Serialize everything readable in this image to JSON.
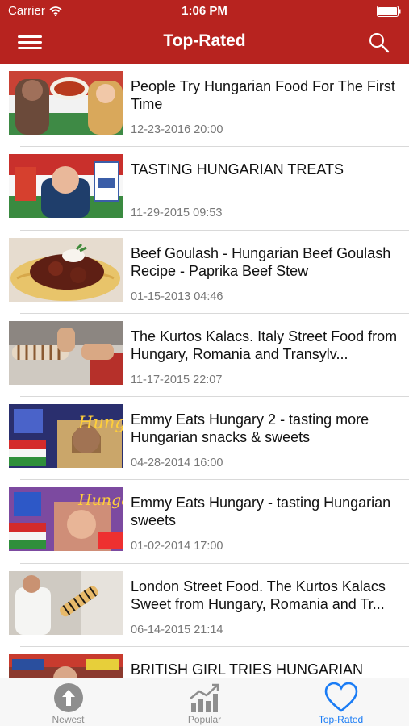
{
  "status_bar": {
    "carrier": "Carrier",
    "time": "1:06 PM"
  },
  "nav": {
    "title": "Top-Rated"
  },
  "videos": [
    {
      "title": "People Try Hungarian Food For The First Time",
      "date": "12-23-2016 20:00"
    },
    {
      "title": "TASTING HUNGARIAN TREATS",
      "date": "11-29-2015 09:53"
    },
    {
      "title": "Beef Goulash - Hungarian Beef Goulash Recipe - Paprika Beef Stew",
      "date": "01-15-2013 04:46"
    },
    {
      "title": "The Kurtos Kalacs. Italy Street Food from Hungary, Romania and Transylv...",
      "date": "11-17-2015 22:07"
    },
    {
      "title": "Emmy Eats Hungary 2 - tasting more Hungarian snacks & sweets",
      "date": "04-28-2014 16:00"
    },
    {
      "title": "Emmy Eats Hungary - tasting Hungarian sweets",
      "date": "01-02-2014 17:00"
    },
    {
      "title": "London Street Food. The Kurtos Kalacs Sweet from Hungary, Romania and Tr...",
      "date": "06-14-2015 21:14"
    },
    {
      "title": "BRITISH GIRL TRIES HUNGARIAN",
      "date": ""
    }
  ],
  "thumb_text": {
    "v5": "Hungary",
    "v6": "Hungary"
  },
  "tabs": [
    {
      "label": "Newest",
      "icon": "arrow-up-circle-icon",
      "active": false
    },
    {
      "label": "Popular",
      "icon": "trending-chart-icon",
      "active": false
    },
    {
      "label": "Top-Rated",
      "icon": "heart-icon",
      "active": true
    }
  ],
  "colors": {
    "brand": "#b7231f",
    "tab_active": "#1a7cf5",
    "tab_inactive": "#8e8e8e",
    "date": "#777777"
  }
}
